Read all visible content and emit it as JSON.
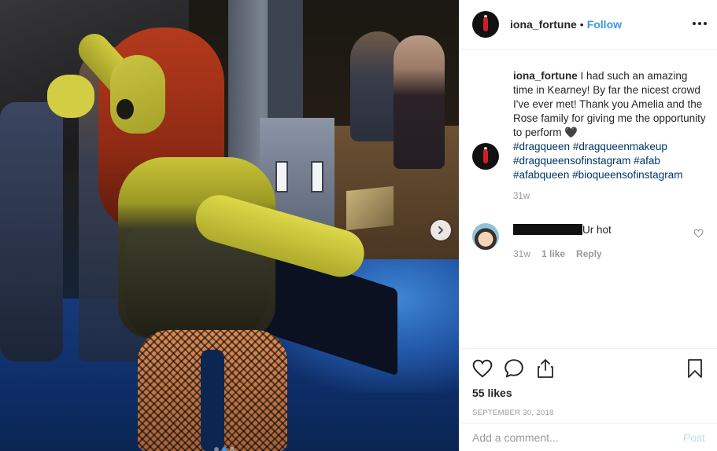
{
  "post": {
    "username": "iona_fortune",
    "separator": "•",
    "follow_label": "Follow",
    "more_label": "•••",
    "carousel": {
      "slides": 3,
      "active_index": 1
    }
  },
  "caption": {
    "username": "iona_fortune",
    "text": " I had such an amazing time in Kearney! By far the nicest crowd I've ever met! Thank you Amelia and the Rose family for giving me the opportunity to perform 🖤",
    "hashtags": [
      "#dragqueen",
      "#dragqueenmakeup",
      "#dragqueensofinstagram",
      "#afab",
      "#afabqueen",
      "#bioqueensofinstagram"
    ],
    "time_ago": "31w"
  },
  "comment": {
    "text": "Ur hot",
    "time_ago": "31w",
    "likes": "1 like",
    "reply_label": "Reply"
  },
  "actions": {
    "likes": "55 likes",
    "date": "SEPTEMBER 30, 2018"
  },
  "composer": {
    "placeholder": "Add a comment...",
    "post_label": "Post"
  }
}
